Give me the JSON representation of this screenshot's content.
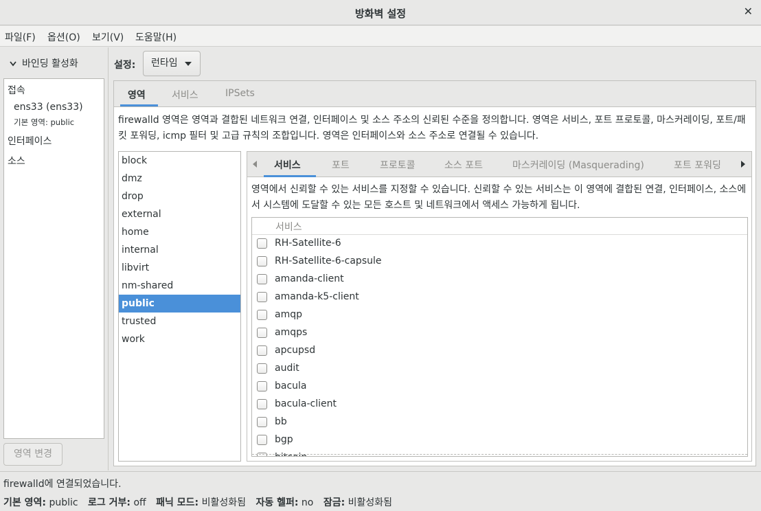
{
  "window": {
    "title": "방화벽 설정"
  },
  "menu": [
    "파일(F)",
    "옵션(O)",
    "보기(V)",
    "도움말(H)"
  ],
  "binding": {
    "toggle_label": "바인딩 활성화",
    "connections_header": "접속",
    "connection_name": "ens33 (ens33)",
    "connection_zone": "기본 영역: public",
    "interfaces_header": "인터페이스",
    "sources_header": "소스",
    "zone_change_button": "영역 변경"
  },
  "settings": {
    "label": "설정:",
    "mode": "런타임"
  },
  "main_tabs": [
    "영역",
    "서비스",
    "IPSets"
  ],
  "zone_description": "firewalld 영역은 영역과 결합된 네트워크 연결, 인터페이스 및 소스 주소의 신뢰된 수준을 정의합니다. 영역은 서비스, 포트 프로토콜, 마스커레이딩, 포트/패킷 포워딩, icmp 필터 및 고급 규칙의 조합입니다. 영역은 인터페이스와 소스 주소로 연결될 수 있습니다.",
  "zones": [
    "block",
    "dmz",
    "drop",
    "external",
    "home",
    "internal",
    "libvirt",
    "nm-shared",
    "public",
    "trusted",
    "work"
  ],
  "selected_zone": "public",
  "zone_tabs": [
    "서비스",
    "포트",
    "프로토콜",
    "소스 포트",
    "마스커레이딩 (Masquerading)",
    "포트 포워딩"
  ],
  "service_description": "영역에서 신뢰할 수 있는 서비스를 지정할 수 있습니다. 신뢰할 수 있는 서비스는 이 영역에 결합된 연결, 인터페이스, 소스에서 시스템에 도달할 수 있는 모든 호스트 및 네트워크에서 액세스 가능하게 됩니다.",
  "service_column_header": "서비스",
  "services": [
    "RH-Satellite-6",
    "RH-Satellite-6-capsule",
    "amanda-client",
    "amanda-k5-client",
    "amqp",
    "amqps",
    "apcupsd",
    "audit",
    "bacula",
    "bacula-client",
    "bb",
    "bgp",
    "bitcoin"
  ],
  "status": {
    "message": "firewalld에 연결되었습니다.",
    "default_zone_label": "기본 영역:",
    "default_zone": "public",
    "log_denied_label": "로그 거부:",
    "log_denied": "off",
    "panic_label": "패닉 모드:",
    "panic": "비활성화됨",
    "helper_label": "자동 헬퍼:",
    "helper": "no",
    "lockdown_label": "잠금:",
    "lockdown": "비활성화됨"
  }
}
